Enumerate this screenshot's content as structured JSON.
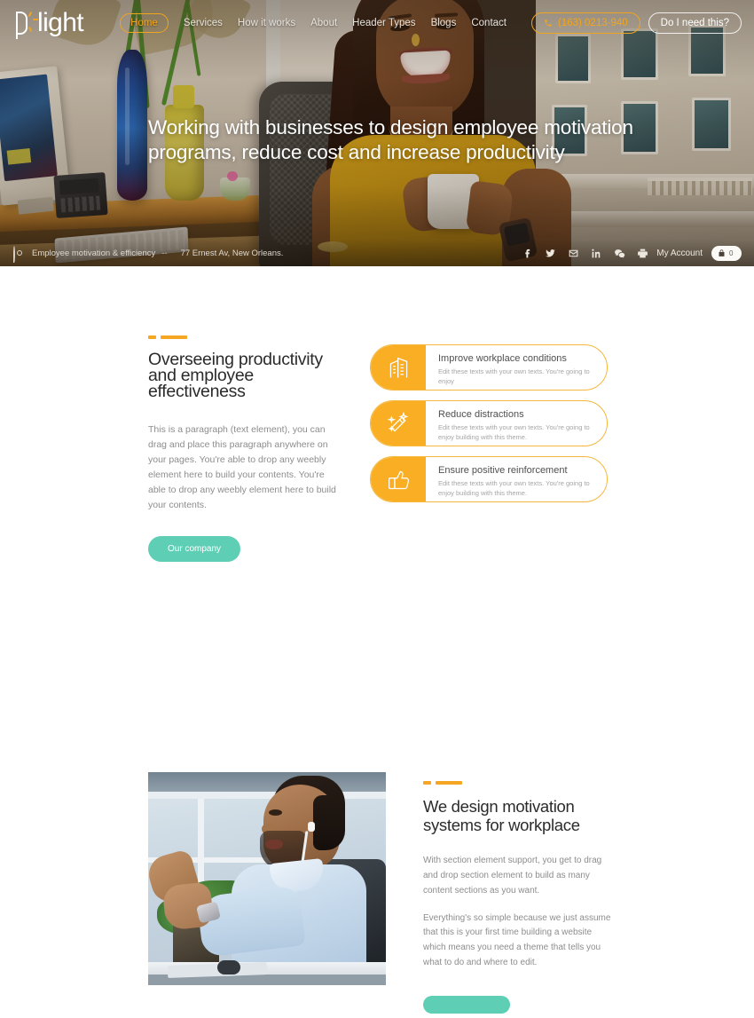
{
  "header": {
    "logo_text": "light",
    "logo_mark": "spark-p-mark",
    "nav": [
      {
        "label": "Home",
        "active": true
      },
      {
        "label": "Services",
        "active": false
      },
      {
        "label": "How it works",
        "active": false
      },
      {
        "label": "About",
        "active": false
      },
      {
        "label": "Header Types",
        "active": false
      },
      {
        "label": "Blogs",
        "active": false
      },
      {
        "label": "Contact",
        "active": false
      }
    ],
    "phone_button": "(163) 0213-940",
    "cta_button": "Do I need this?",
    "accent_color": "#f0a51e"
  },
  "hero": {
    "heading": "Working with businesses to design employee motivation programs, reduce cost and increase productivity",
    "tagline": "Employee motivation & efficiency",
    "separator": "--",
    "address": "77 Ernest Av, New Orleans.",
    "socials": [
      "facebook-icon",
      "twitter-icon",
      "email-icon",
      "linkedin-icon",
      "wechat-icon",
      "youtube-icon"
    ],
    "account_label": "My Account",
    "cart_count": "0",
    "image_description": "Smiling woman in mustard top holding a coffee mug at an office desk with vases and a building facade behind"
  },
  "section_one": {
    "heading": "Overseeing productivity and employee effectiveness",
    "paragraph": "This is a paragraph (text element), you can drag and place this paragraph anywhere on your pages. You're able to drop any weebly element here to build your contents. You're able to drop any weebly element here to build your contents.",
    "button_label": "Our company",
    "button_color": "#5ecfb4",
    "accent_color": "#f5a623",
    "cards": [
      {
        "icon": "building-icon",
        "title": "Improve workplace conditions",
        "description": "Edit these texts with your own texts. You're going to enjoy"
      },
      {
        "icon": "magic-wand-icon",
        "title": "Reduce distractions",
        "description": "Edit these texts with your own texts. You're going to enjoy building with this theme."
      },
      {
        "icon": "thumbs-up-icon",
        "title": "Ensure positive reinforcement",
        "description": "Edit these texts with your own texts. You're going to enjoy building with this theme."
      }
    ]
  },
  "section_two": {
    "heading": "We design motivation systems for workplace",
    "paragraph_one": "With section element support, you get to drag and drop section element to build as many content sections as you want.",
    "paragraph_two": "Everything's so simple because we just assume that this is your first time building a website which means you need a theme that tells you what to do and where to edit.",
    "button_label": "",
    "button_color": "#5ecfb4",
    "image_description": "Man with earbuds gesturing while speaking at an office desk by a window"
  }
}
